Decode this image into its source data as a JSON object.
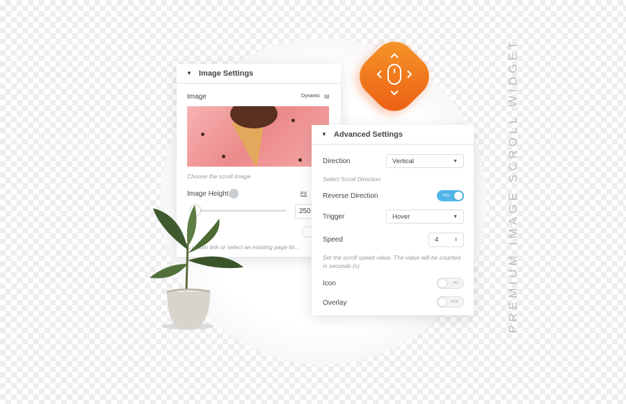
{
  "image_settings": {
    "title": "Image Settings",
    "image_label": "Image",
    "dynamic_label": "Dynamic",
    "image_hint": "Choose the scroll image",
    "height_label": "Image Height",
    "unit": "PX",
    "height_value": "250",
    "link_hint": "...ustom link or select an existing page lin..."
  },
  "advanced_settings": {
    "title": "Advanced Settings",
    "direction_label": "Direction",
    "direction_value": "Vertical",
    "direction_hint": "Select Scroll Direction",
    "reverse_label": "Reverse Direction",
    "reverse_state": "YES",
    "reverse_on": true,
    "trigger_label": "Trigger",
    "trigger_value": "Hover",
    "speed_label": "Speed",
    "speed_value": "4",
    "speed_hint": "Set the scroll speed value. The value will be counted in seconds (s)",
    "icon_label": "Icon",
    "icon_state": "NO",
    "overlay_label": "Overlay",
    "overlay_state": "HIDE"
  },
  "side_title": "PREMIUM IMAGE SCROLL WIDGET",
  "colors": {
    "accent": "#ec6a18",
    "toggle_on": "#4fb6e7"
  },
  "icons": {
    "badge": "mouse-scroll-icon"
  }
}
